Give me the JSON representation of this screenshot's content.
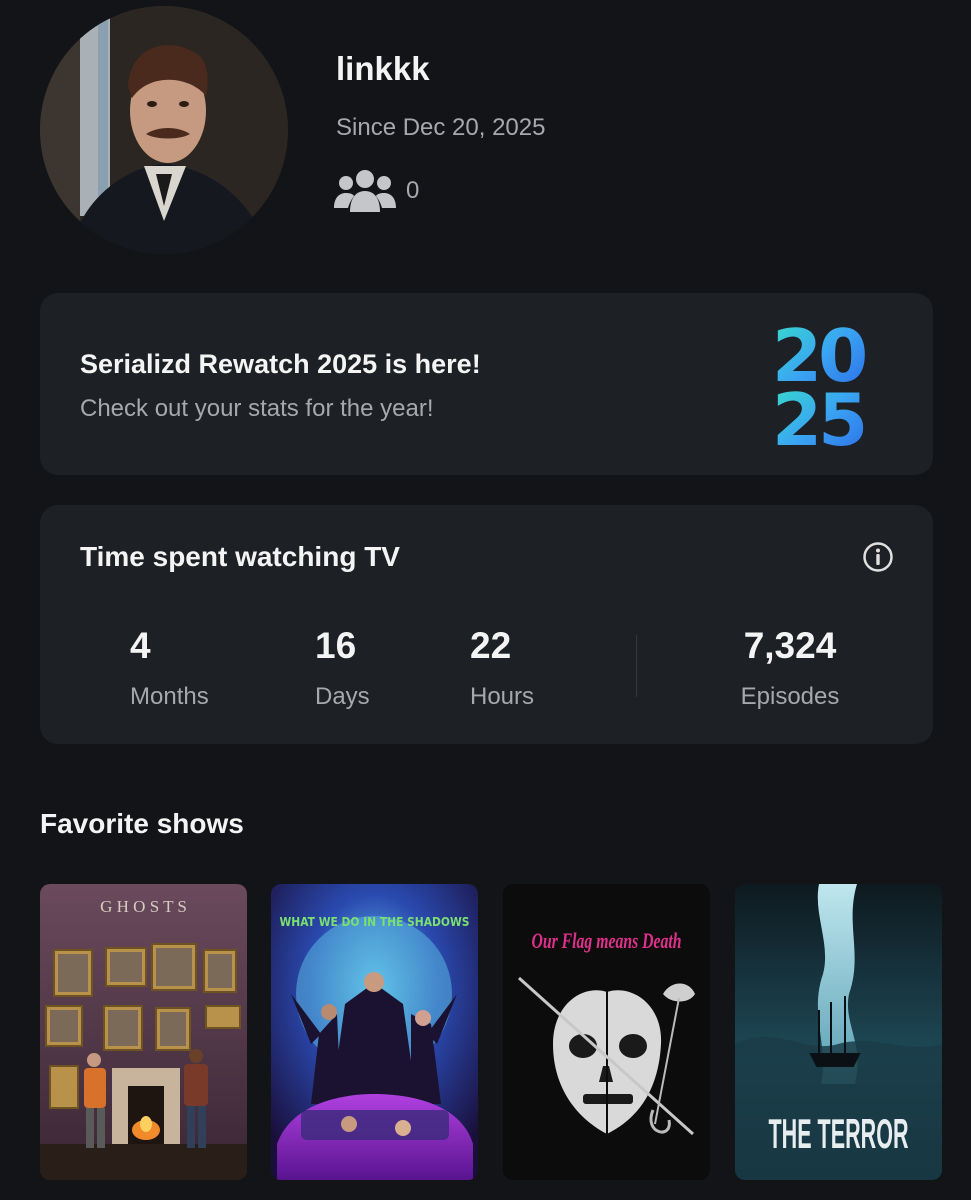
{
  "profile": {
    "username": "linkkk",
    "since": "Since Dec 20, 2025",
    "friends_count": "0"
  },
  "rewatch": {
    "title": "Serializd Rewatch 2025 is here!",
    "subtitle": "Check out your stats for the year!",
    "year_top": "20",
    "year_bottom": "25"
  },
  "watch_time": {
    "title": "Time spent watching TV",
    "stats": [
      {
        "value": "4",
        "label": "Months"
      },
      {
        "value": "16",
        "label": "Days"
      },
      {
        "value": "22",
        "label": "Hours"
      },
      {
        "value": "7,324",
        "label": "Episodes"
      }
    ]
  },
  "favorites": {
    "title": "Favorite shows",
    "shows": [
      {
        "poster_text": "G H O S T S",
        "icon": "ghosts-poster"
      },
      {
        "poster_text": "WHAT WE DO IN THE SHADOWS",
        "icon": "shadows-poster"
      },
      {
        "poster_text": "Our Flag means Death",
        "icon": "flag-poster"
      },
      {
        "poster_text": "THE TERROR",
        "icon": "terror-poster"
      }
    ]
  },
  "colors": {
    "background": "#131417",
    "card": "#1d2024",
    "muted_text": "#a6a8ad"
  }
}
